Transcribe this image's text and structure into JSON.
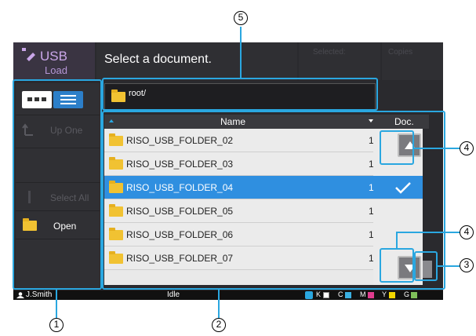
{
  "header": {
    "app_title": "USB",
    "app_subtitle": "Load",
    "message": "Select a document.",
    "selected_label": "Selected:",
    "copies_label": "Copies"
  },
  "sidebar": {
    "up_one_label": "Up One",
    "select_all_label": "Select All",
    "open_label": "Open"
  },
  "path": "root/",
  "list": {
    "columns": [
      "Name",
      "Doc."
    ],
    "rows": [
      {
        "name": "RISO_USB_FOLDER_02",
        "doc": "1"
      },
      {
        "name": "RISO_USB_FOLDER_03",
        "doc": "1"
      },
      {
        "name": "RISO_USB_FOLDER_04",
        "doc": "1",
        "selected": true
      },
      {
        "name": "RISO_USB_FOLDER_05",
        "doc": "1"
      },
      {
        "name": "RISO_USB_FOLDER_06",
        "doc": "1"
      },
      {
        "name": "RISO_USB_FOLDER_07",
        "doc": "1"
      }
    ]
  },
  "status": {
    "user": "J.Smith",
    "state": "Idle",
    "inks": [
      "K",
      "C",
      "M",
      "Y",
      "G"
    ]
  },
  "callouts": [
    "1",
    "2",
    "3",
    "4",
    "4",
    "5"
  ],
  "colors": {
    "accent": "#2aa7e0",
    "selected_row": "#2f8fe0",
    "usb_purple": "#c9a6e8",
    "folder": "#f1c232"
  }
}
